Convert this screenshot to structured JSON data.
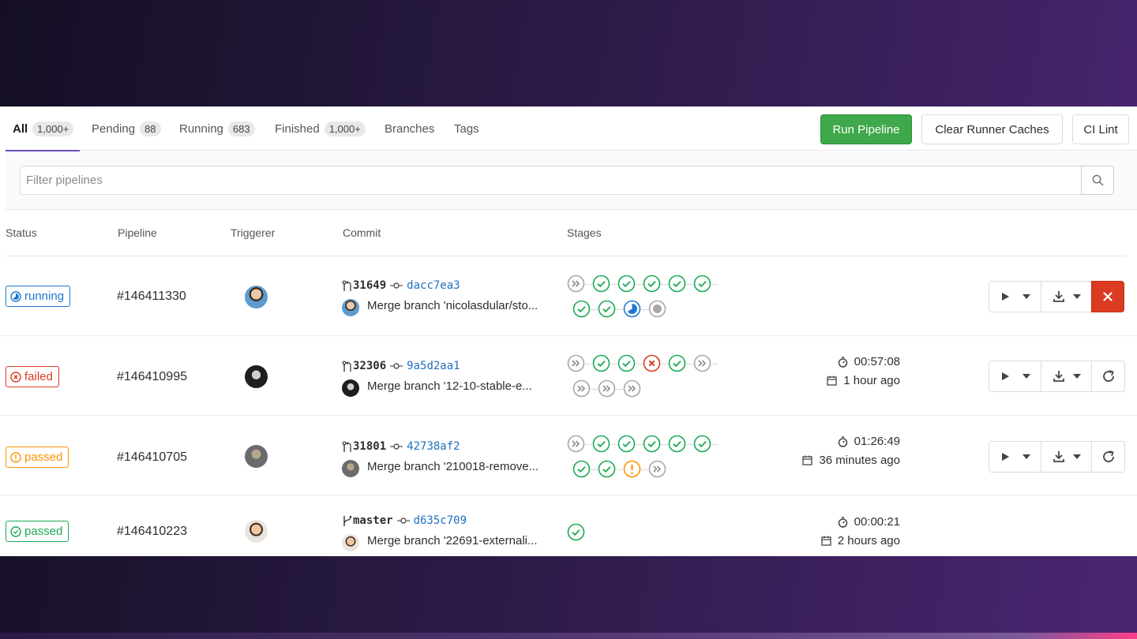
{
  "tabs": [
    {
      "label": "All",
      "count": "1,000+"
    },
    {
      "label": "Pending",
      "count": "88"
    },
    {
      "label": "Running",
      "count": "683"
    },
    {
      "label": "Finished",
      "count": "1,000+"
    },
    {
      "label": "Branches"
    },
    {
      "label": "Tags"
    }
  ],
  "toolbar": {
    "run_pipeline": "Run Pipeline",
    "clear_caches": "Clear Runner Caches",
    "ci_lint": "CI Lint"
  },
  "filter": {
    "placeholder": "Filter pipelines",
    "search_icon": "search-icon"
  },
  "columns": [
    "Status",
    "Pipeline",
    "Triggerer",
    "Commit",
    "Stages"
  ],
  "colors": {
    "running": "#1f78d1",
    "failed": "#db3b21",
    "warning": "#fc9403",
    "passed": "#1aaa55",
    "skipped": "#a7a7a7",
    "cancel": "#db3b21",
    "run_button": "#3fa84a"
  },
  "pipelines": [
    {
      "status": "running",
      "id": "#146411330",
      "ref_type": "merge-request",
      "ref": "31649",
      "sha": "dacc7ea3",
      "message": "Merge branch 'nicolasdular/sto...",
      "stages_row1": [
        "skipped",
        "passed",
        "passed",
        "passed",
        "passed",
        "passed"
      ],
      "stages_row2": [
        "passed",
        "passed",
        "running",
        "created"
      ],
      "duration": "",
      "finished": "",
      "action_end": "cancel"
    },
    {
      "status": "failed",
      "id": "#146410995",
      "ref_type": "merge-request",
      "ref": "32306",
      "sha": "9a5d2aa1",
      "message": "Merge branch '12-10-stable-e...",
      "stages_row1": [
        "skipped",
        "passed",
        "passed",
        "failed",
        "passed",
        "skipped"
      ],
      "stages_row2": [
        "skipped",
        "skipped",
        "skipped"
      ],
      "duration": "00:57:08",
      "finished": "1 hour ago",
      "action_end": "retry"
    },
    {
      "status": "passed",
      "status_variant": "warning",
      "id": "#146410705",
      "ref_type": "merge-request",
      "ref": "31801",
      "sha": "42738af2",
      "message": "Merge branch '210018-remove...",
      "stages_row1": [
        "skipped",
        "passed",
        "passed",
        "passed",
        "passed",
        "passed"
      ],
      "stages_row2": [
        "passed",
        "passed",
        "warning",
        "skipped"
      ],
      "duration": "01:26:49",
      "finished": "36 minutes ago",
      "action_end": "retry"
    },
    {
      "status": "passed",
      "id": "#146410223",
      "ref_type": "branch",
      "ref": "master",
      "sha": "d635c709",
      "message": "Merge branch '22691-externali...",
      "stages_row1": [
        "passed"
      ],
      "stages_row2": [],
      "duration": "00:00:21",
      "finished": "2 hours ago",
      "action_end": "none"
    }
  ]
}
